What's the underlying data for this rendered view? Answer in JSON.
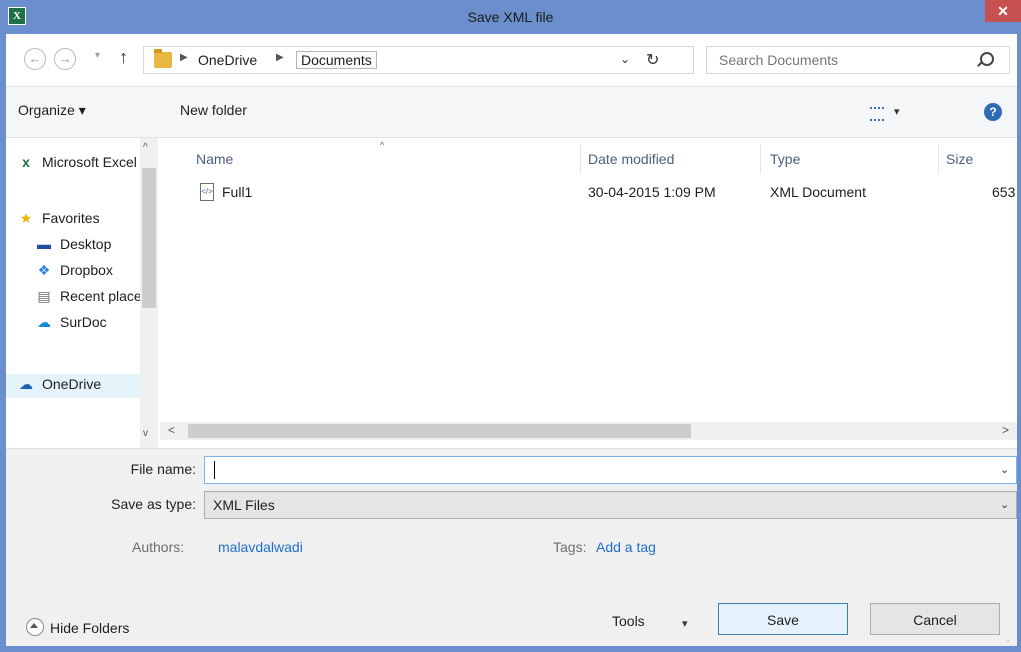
{
  "window": {
    "title": "Save XML file",
    "close_glyph": "✕"
  },
  "nav": {
    "back": "←",
    "forward": "→",
    "history": "▾",
    "up": "↑"
  },
  "address": {
    "crumbs": [
      "OneDrive",
      "Documents"
    ],
    "separator": "▶",
    "dropdown": "⌄",
    "refresh": "↻"
  },
  "search": {
    "placeholder": "Search Documents"
  },
  "toolbar": {
    "organize": "Organize ▾",
    "new_folder": "New folder",
    "view_dd": "▾",
    "help": "?"
  },
  "sidebar": {
    "items": [
      {
        "label": "Microsoft Excel",
        "icon": "excel-icon",
        "glyph": "x"
      },
      {
        "label": "Favorites",
        "icon": "star-icon",
        "glyph": "★"
      },
      {
        "label": "Desktop",
        "icon": "desktop-icon",
        "glyph": "▬"
      },
      {
        "label": "Dropbox",
        "icon": "dropbox-icon",
        "glyph": "❖"
      },
      {
        "label": "Recent places",
        "icon": "recent-places-icon",
        "glyph": "▤"
      },
      {
        "label": "SurDoc",
        "icon": "surdoc-icon",
        "glyph": "☁"
      },
      {
        "label": "OneDrive",
        "icon": "onedrive-icon",
        "glyph": "☁"
      }
    ],
    "scroll_up": "^",
    "scroll_down": "v"
  },
  "files": {
    "columns": [
      "Name",
      "Date modified",
      "Type",
      "Size"
    ],
    "sort_caret": "^",
    "rows": [
      {
        "name": "Full1",
        "date": "30-04-2015 1:09 PM",
        "type": "XML Document",
        "size": "653"
      }
    ],
    "scroll_left": "<",
    "scroll_right": ">"
  },
  "form": {
    "file_name_label": "File name:",
    "file_name_value": "",
    "save_type_label": "Save as type:",
    "save_type_value": "XML Files",
    "chevron": "⌄"
  },
  "meta": {
    "authors_label": "Authors:",
    "authors_value": "malavdalwadi",
    "tags_label": "Tags:",
    "tags_value": "Add a tag"
  },
  "footer": {
    "hide_folders": "Hide Folders",
    "tools": "Tools",
    "tools_dd": "▾",
    "save": "Save",
    "cancel": "Cancel",
    "grip": "⠠"
  },
  "colors": {
    "titlebar": "#6b8fcc",
    "close": "#c75050",
    "link": "#1e6fd0",
    "column_header": "#4c607a"
  }
}
